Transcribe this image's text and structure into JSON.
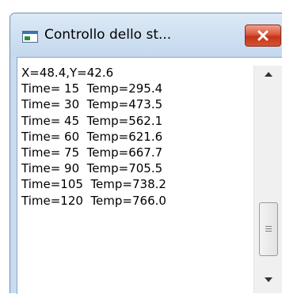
{
  "window": {
    "title": "Controllo dello st..."
  },
  "console": {
    "lines": [
      "X=48.4,Y=42.6",
      "Time= 15  Temp=295.4",
      "Time= 30  Temp=473.5",
      "Time= 45  Temp=562.1",
      "Time= 60  Temp=621.6",
      "Time= 75  Temp=667.7",
      "Time= 90  Temp=705.5",
      "Time=105  Temp=738.2",
      "Time=120  Temp=766.0"
    ]
  },
  "colors": {
    "title_bar": "#c9dcef",
    "close_button": "#d9573c"
  },
  "icons": {
    "window_icon": "app-window-icon",
    "close": "close-icon",
    "scroll_up": "scroll-up-arrow-icon",
    "scroll_down": "scroll-down-arrow-icon"
  }
}
